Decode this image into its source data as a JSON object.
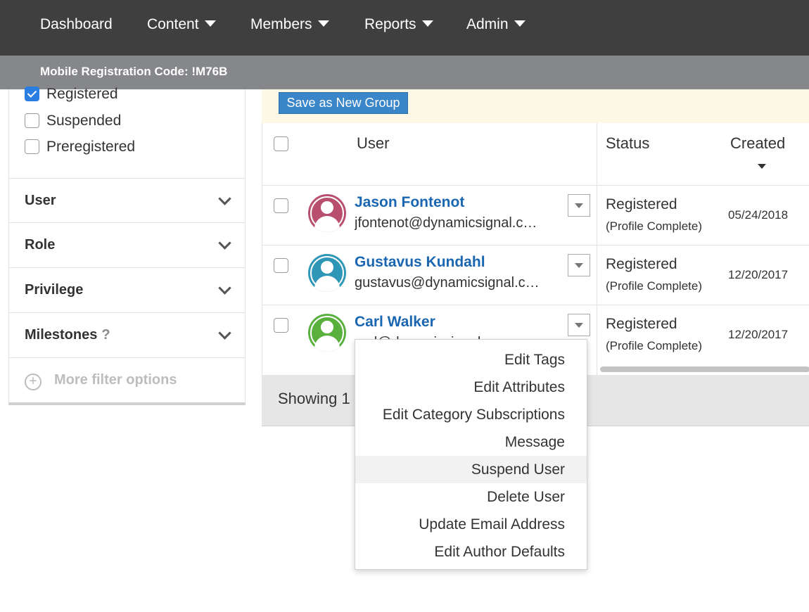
{
  "nav": {
    "items": [
      {
        "label": "Dashboard",
        "dropdown": false
      },
      {
        "label": "Content",
        "dropdown": true
      },
      {
        "label": "Members",
        "dropdown": true
      },
      {
        "label": "Reports",
        "dropdown": true
      },
      {
        "label": "Admin",
        "dropdown": true
      }
    ]
  },
  "subbar": {
    "text": "Mobile Registration Code: !M76B"
  },
  "sidebar": {
    "status_options": [
      {
        "label": "Registered",
        "checked": true
      },
      {
        "label": "Suspended",
        "checked": false
      },
      {
        "label": "Preregistered",
        "checked": false
      }
    ],
    "filters": [
      {
        "label": "User"
      },
      {
        "label": "Role"
      },
      {
        "label": "Privilege"
      },
      {
        "label": "Milestones",
        "help": "?"
      }
    ],
    "more_filters": "More filter options"
  },
  "toolbar": {
    "save_group_label": "Save as New Group"
  },
  "table": {
    "headers": {
      "user": "User",
      "status": "Status",
      "created": "Created"
    },
    "rows": [
      {
        "name": "Jason Fontenot",
        "email": "jfontenot@dynamicsignal.c…",
        "status": "Registered",
        "substatus": "(Profile Complete)",
        "created": "05/24/2018",
        "avatar_color": "#b94f6f"
      },
      {
        "name": "Gustavus Kundahl",
        "email": "gustavus@dynamicsignal.c…",
        "status": "Registered",
        "substatus": "(Profile Complete)",
        "created": "12/20/2017",
        "avatar_color": "#2e97b7"
      },
      {
        "name": "Carl Walker",
        "email": "carl@dynamicsignal.c…",
        "status": "Registered",
        "substatus": "(Profile Complete)",
        "created": "12/20/2017",
        "avatar_color": "#59b03c"
      }
    ]
  },
  "footer": {
    "showing_text": "Showing 1"
  },
  "row_menu": {
    "items": [
      {
        "label": "Edit Tags"
      },
      {
        "label": "Edit Attributes"
      },
      {
        "label": "Edit Category Subscriptions"
      },
      {
        "label": "Message"
      },
      {
        "label": "Suspend User",
        "highlighted": true
      },
      {
        "label": "Delete User"
      },
      {
        "label": "Update Email Address"
      },
      {
        "label": "Edit Author Defaults"
      }
    ]
  }
}
